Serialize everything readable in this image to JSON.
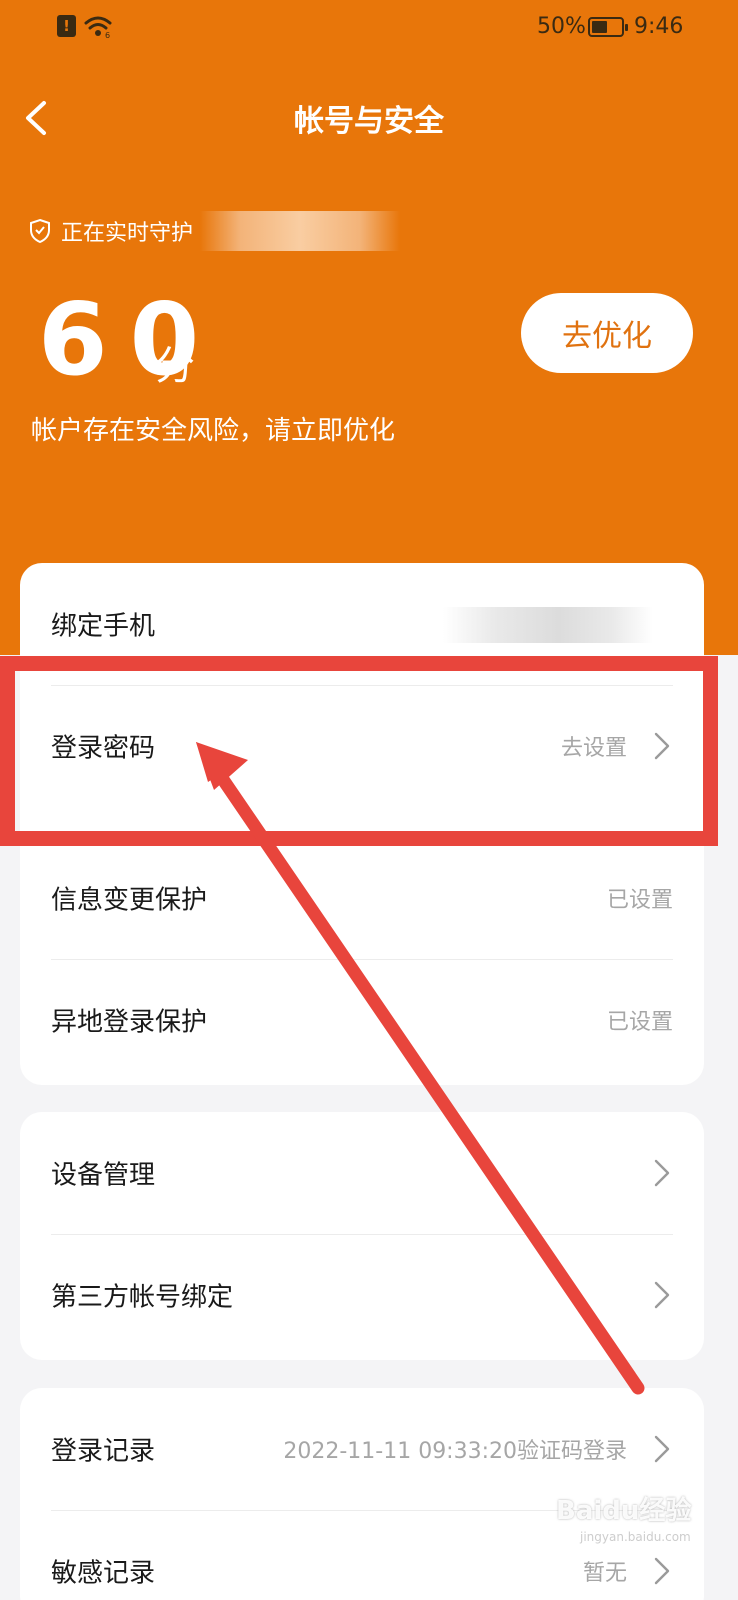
{
  "status_bar": {
    "battery_percent": "50%",
    "time": "9:46",
    "notice_icon": "notice-icon",
    "wifi_icon": "wifi-icon"
  },
  "nav": {
    "title": "帐号与安全",
    "back_icon": "back-icon"
  },
  "header": {
    "guard_text": "正在实时守护",
    "score": "60",
    "score_unit": "分",
    "risk_text": "帐户存在安全风险，请立即优化",
    "optimize_label": "去优化",
    "background_color": "#e8760a"
  },
  "card1": {
    "rows": [
      {
        "label": "绑定手机",
        "value": ""
      },
      {
        "label": "登录密码",
        "value": "去设置"
      },
      {
        "label": "信息变更保护",
        "value": "已设置"
      },
      {
        "label": "异地登录保护",
        "value": "已设置"
      }
    ]
  },
  "card2": {
    "rows": [
      {
        "label": "设备管理"
      },
      {
        "label": "第三方帐号绑定"
      }
    ]
  },
  "card3": {
    "rows": [
      {
        "label": "登录记录",
        "value": "2022-11-11 09:33:20验证码登录"
      },
      {
        "label": "敏感记录",
        "value": "暂无"
      }
    ]
  },
  "annotation": {
    "highlight_color": "#e8453c"
  },
  "watermark": {
    "text": "Baidu经验",
    "sub": "jingyan.baidu.com"
  }
}
